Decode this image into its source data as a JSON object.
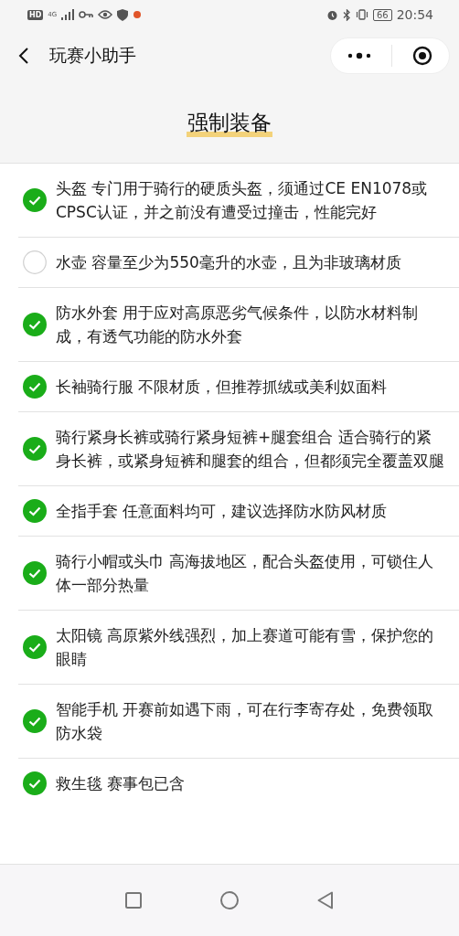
{
  "status_bar": {
    "hd": "HD",
    "network": "4G",
    "battery": "66",
    "time": "20:54"
  },
  "nav": {
    "title": "玩赛小助手"
  },
  "heading": "强制装备",
  "items": [
    {
      "text": "头盔 专门用于骑行的硬质头盔，须通过CE EN1078或CPSC认证，并之前没有遭受过撞击，性能完好",
      "checked": true
    },
    {
      "text": "水壶 容量至少为550毫升的水壶，且为非玻璃材质",
      "checked": false
    },
    {
      "text": "防水外套 用于应对高原恶劣气候条件，以防水材料制成，有透气功能的防水外套",
      "checked": true
    },
    {
      "text": "长袖骑行服 不限材质，但推荐抓绒或美利奴面料",
      "checked": true
    },
    {
      "text": "骑行紧身长裤或骑行紧身短裤+腿套组合 适合骑行的紧身长裤，或紧身短裤和腿套的组合，但都须完全覆盖双腿",
      "checked": true
    },
    {
      "text": "全指手套 任意面料均可，建议选择防水防风材质",
      "checked": true
    },
    {
      "text": "骑行小帽或头巾 高海拔地区，配合头盔使用，可锁住人体一部分热量",
      "checked": true
    },
    {
      "text": "太阳镜 高原紫外线强烈，加上赛道可能有雪，保护您的眼睛",
      "checked": true
    },
    {
      "text": "智能手机 开赛前如遇下雨，可在行李寄存处，免费领取防水袋",
      "checked": true
    },
    {
      "text": "救生毯 赛事包已含",
      "checked": true
    }
  ]
}
